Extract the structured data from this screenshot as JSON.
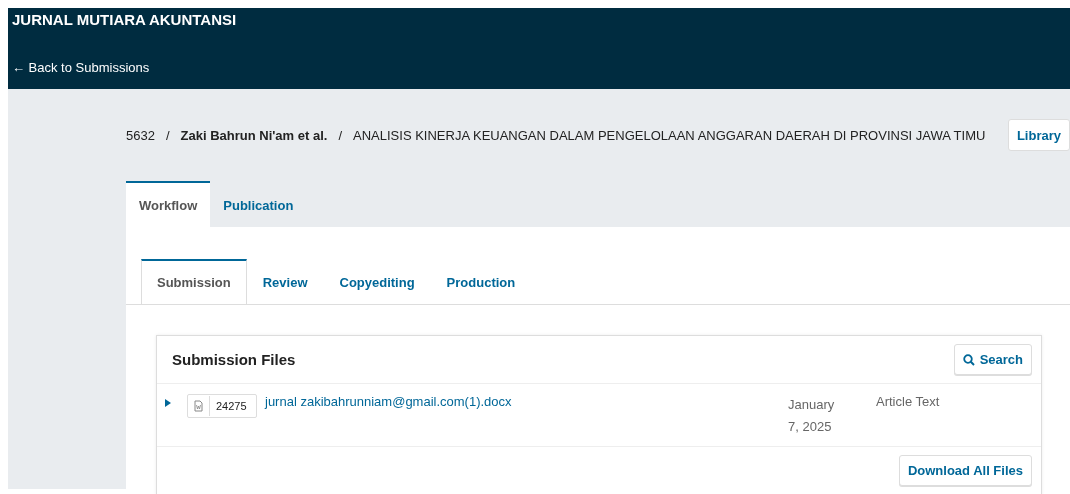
{
  "header": {
    "journal": "JURNAL MUTIARA AKUNTANSI",
    "back_link": "← Back to Submissions"
  },
  "breadcrumb": {
    "id": "5632",
    "separator": "/",
    "authors": "Zaki Bahrun Ni'am et al.",
    "title": "ANALISIS KINERJA KEUANGAN DALAM PENGELOLAAN ANGGARAN DAERAH DI PROVINSI JAWA TIMU",
    "library_button": "Library"
  },
  "tabs": [
    {
      "label": "Workflow",
      "selected": true
    },
    {
      "label": "Publication",
      "selected": false
    }
  ],
  "stage_tabs": [
    {
      "label": "Submission",
      "selected": true
    },
    {
      "label": "Review",
      "selected": false
    },
    {
      "label": "Copyediting",
      "selected": false
    },
    {
      "label": "Production",
      "selected": false
    }
  ],
  "files_panel": {
    "title": "Submission Files",
    "search_button": "Search",
    "download_button": "Download All Files",
    "rows": [
      {
        "expanded": false,
        "file_id": "24275",
        "name": "jurnal zakibahrunniam@gmail.com(1).docx",
        "date": "January 7, 2025",
        "type": "Article Text"
      }
    ]
  }
}
